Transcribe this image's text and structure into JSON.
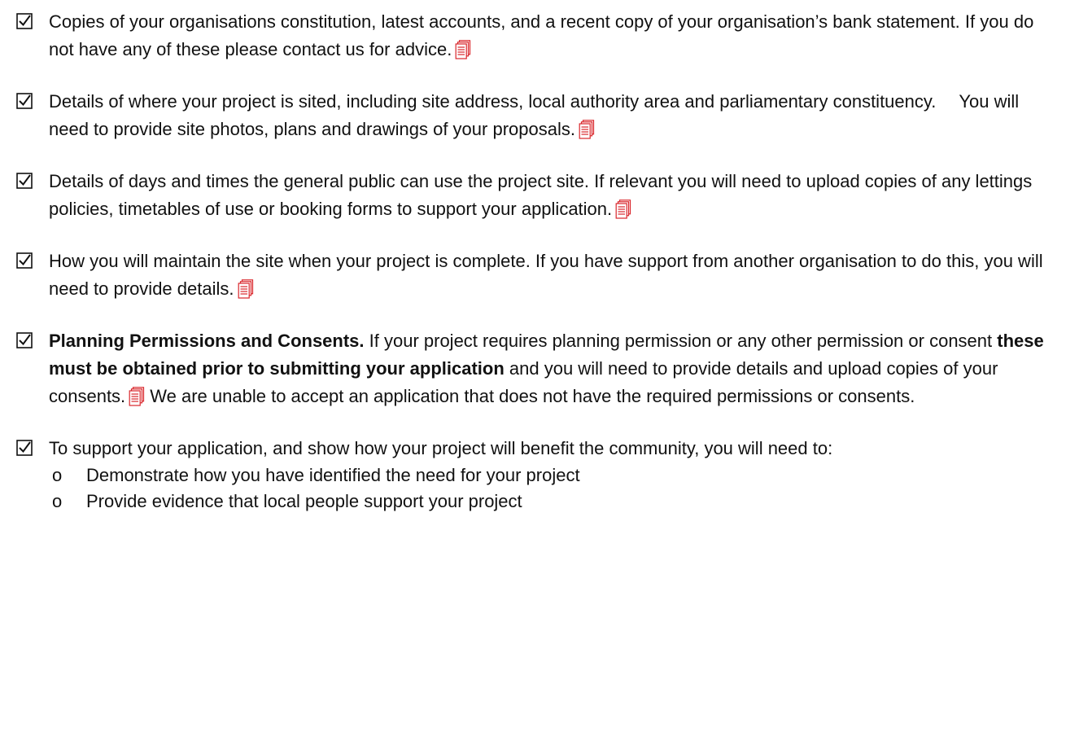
{
  "items": [
    {
      "text": "Copies of your organisations constitution, latest accounts, and a recent copy of your organisation’s bank statement.  If you do not have any of these please contact us for advice."
    },
    {
      "text_a": "Details of where your project is sited, including site address, local authority area and parliamentary constituency.",
      "text_b": "You will need to provide site photos, plans and drawings of your proposals."
    },
    {
      "text": "Details of days and times the general public can use the project site.   If relevant you will need to upload copies of any lettings policies, timetables of use or booking forms to support your application."
    },
    {
      "text": "How you will maintain the site when your project is complete.   If you have support from another organisation to do this, you will need to provide details."
    },
    {
      "bold_a": "Planning Permissions and Consents.",
      "text_a": " If your project requires planning permission or any other permission or consent ",
      "bold_b": "these must be obtained prior to submitting your application",
      "text_b": " and you will need to provide details and upload copies of your consents.",
      "text_c": " We are unable to accept an application that does not have the required permissions or consents."
    },
    {
      "text": "To support your application, and show how your project will benefit the community, you will need to:",
      "bullet": "o",
      "subitems": [
        "Demonstrate how you have identified the need for your project",
        "Provide evidence that local people support your project"
      ]
    }
  ],
  "icons": {
    "check": "checkbox-checked-icon",
    "document": "document-icon"
  },
  "colors": {
    "text": "#111111",
    "document_icon": "#d9262b"
  }
}
